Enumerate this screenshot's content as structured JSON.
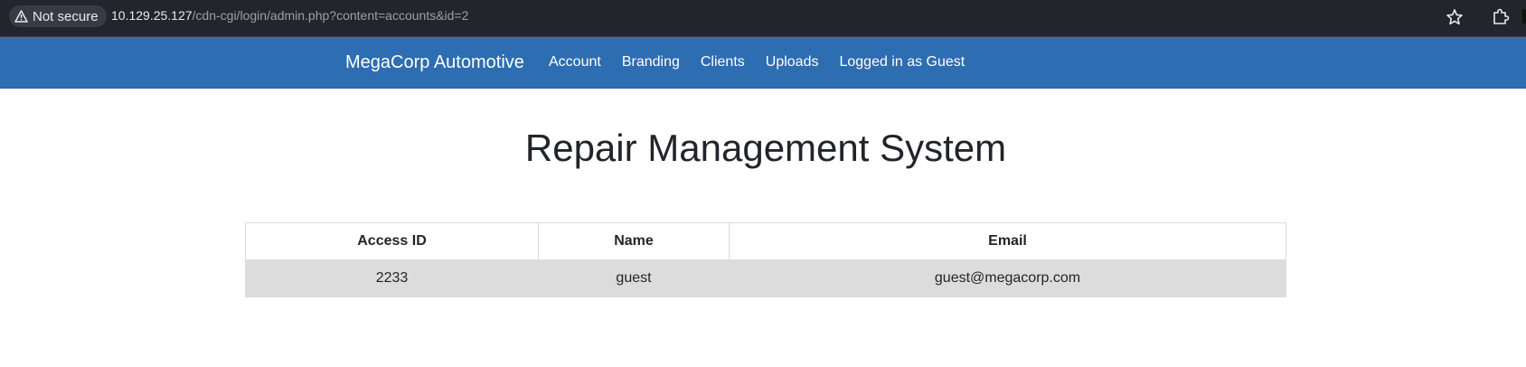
{
  "browser": {
    "security_label": "Not secure",
    "url_host": "10.129.25.127",
    "url_path": "/cdn-cgi/login/admin.php?content=accounts&id=2"
  },
  "navbar": {
    "brand": "MegaCorp Automotive",
    "links": [
      "Account",
      "Branding",
      "Clients",
      "Uploads",
      "Logged in as Guest"
    ]
  },
  "main": {
    "title": "Repair Management System",
    "table": {
      "headers": [
        "Access ID",
        "Name",
        "Email"
      ],
      "rows": [
        [
          "2233",
          "guest",
          "guest@megacorp.com"
        ]
      ]
    }
  },
  "colors": {
    "navbar_bg": "#2d6db2",
    "browser_bg": "#23252d",
    "row_bg": "#dcdcdc"
  },
  "icons": [
    "warning-icon",
    "star-icon",
    "extensions-icon"
  ]
}
